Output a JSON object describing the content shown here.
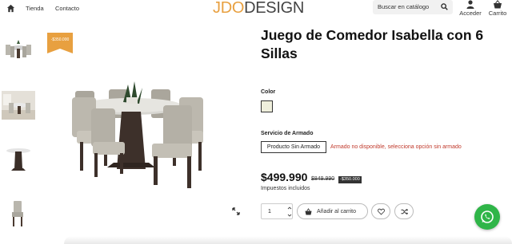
{
  "header": {
    "nav": [
      {
        "label": "Tienda"
      },
      {
        "label": "Contacto"
      }
    ],
    "logo": {
      "part1": "JDO",
      "part2": "DESIGN"
    },
    "search": {
      "placeholder": "Buscar en catálogo"
    },
    "account_label": "Acceder",
    "cart_label": "Carrito"
  },
  "gallery": {
    "sale_badge": "-$350.000"
  },
  "product": {
    "title": "Juego de Comedor Isabella con 6 Sillas",
    "color_label": "Color",
    "service_label": "Servicio de Armado",
    "service_option": "Producto Sin Armado",
    "service_warning": "Armado no disponible, selecciona opción sin armado",
    "price": "$499.990",
    "old_price": "$849.990",
    "discount": "-$350.000",
    "taxes": "Impuestos incluidos",
    "quantity": "1",
    "add_to_cart": "Añadir al carrito"
  },
  "colors": {
    "accent": "#e8a040",
    "warning": "#c0392b",
    "whatsapp": "#2fb548",
    "swatch": "#efefdc"
  }
}
